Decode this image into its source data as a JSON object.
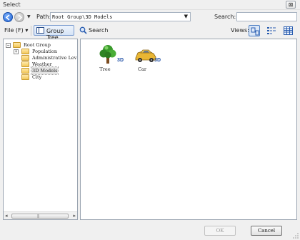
{
  "window": {
    "title": "Select",
    "close_glyph": "⊠"
  },
  "pathbar": {
    "path_label": "Path:",
    "path_value": "Root Group\\3D Models",
    "search_label": "Search:",
    "search_value": ""
  },
  "toolbar": {
    "file_menu": "File (F) ▾",
    "group_tree": "Group Tree",
    "search": "Search",
    "views_label": "Views:"
  },
  "tree": {
    "root": {
      "label": "Root Group",
      "expander": "−"
    },
    "children": [
      {
        "label": "Population",
        "expander": "+"
      },
      {
        "label": "Administrative Lev"
      },
      {
        "label": "Weather"
      },
      {
        "label": "3D Models",
        "selected": true
      },
      {
        "label": "City"
      }
    ],
    "scroll_grip": "|||"
  },
  "items": [
    {
      "label": "Tree",
      "badge": "3D",
      "icon": "tree-3d-icon"
    },
    {
      "label": "Car",
      "badge": "3D",
      "icon": "car-3d-icon"
    }
  ],
  "footer": {
    "ok": "OK",
    "cancel": "Cancel"
  },
  "colors": {
    "accent": "#1f4fa6",
    "folder": "#f2c75a",
    "selection": "#e3e3e3"
  }
}
